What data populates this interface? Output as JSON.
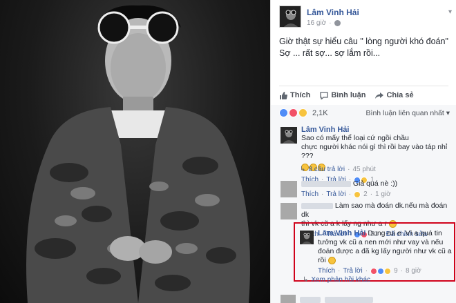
{
  "post": {
    "author": "Lâm Vinh Hải",
    "time": "16 giờ",
    "text_lines": [
      "Giờ thật sự hiểu câu \" lòng người khó đoán\"",
      "Sợ ... rất sợ... sợ lắm rồi..."
    ],
    "actions": {
      "like": "Thích",
      "comment": "Bình luận",
      "share": "Chia sẻ"
    },
    "reaction_count": "2,1K",
    "sort_label": "Bình luận liên quan nhất"
  },
  "comments": [
    {
      "author": "Lâm Vinh Hải",
      "text_lines": [
        "Sao có mấy thể loại cứ ngồi chầu",
        "chực người khác nói gì thì rồi bay vào táp nhỉ ???"
      ],
      "like": "Thích",
      "reply": "Trả lời",
      "count": "1",
      "replies_label": "8 câu trả lời",
      "replies_time": "45 phút"
    },
    {
      "text": "Giả quá nè :))",
      "like": "Thích",
      "reply": "Trả lời",
      "count": "2",
      "time": "1 giờ"
    },
    {
      "text_lines": [
        "Làm sao mà đoán dk.nếu mà đoán dk",
        "thì vk cũ a k lấy ng như a r"
      ],
      "like": "Thích",
      "reply": "Trả lời",
      "count": "51",
      "time": "Đã chỉnh sửa"
    },
    {
      "author": "Lâm Vinh Hải",
      "text_lines": [
        "Dung rui e .Vì a quá tin",
        "tưởng vk cũ a nen mới như vay và nếu",
        "đoán được a đã kg lấy người như vk cũ a",
        "rồi"
      ],
      "like": "Thích",
      "reply": "Trả lời",
      "count": "9",
      "time": "8 giờ"
    }
  ],
  "more_replies": "Xem phản hồi khác",
  "colors": {
    "link": "#365899",
    "highlight": "#d0021b",
    "meta": "#90949c"
  }
}
